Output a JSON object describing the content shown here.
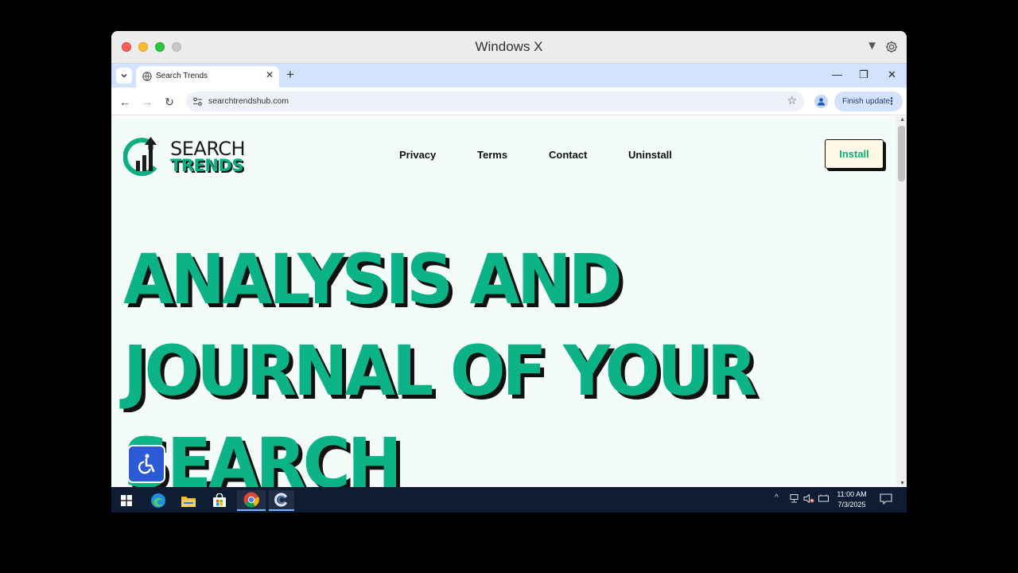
{
  "window": {
    "title": "Windows X",
    "title_arrow": "▼"
  },
  "tabstrip": {
    "tab_title": "Search Trends",
    "tab_close": "✕",
    "new_tab": "+",
    "minimize": "—",
    "restore": "❐",
    "close": "✕"
  },
  "toolbar": {
    "back": "←",
    "forward": "→",
    "reload": "↻",
    "url": "searchtrendshub.com",
    "bookmark_star": "☆",
    "finish_update": "Finish update",
    "menu_dots": "⋮"
  },
  "page": {
    "logo": {
      "line1": "SEARCH",
      "line2": "TRENDS"
    },
    "nav": [
      {
        "label": "Privacy"
      },
      {
        "label": "Terms"
      },
      {
        "label": "Contact"
      },
      {
        "label": "Uninstall"
      }
    ],
    "install_label": "Install",
    "hero": {
      "line1": "ANALYSIS AND",
      "line2": "JOURNAL OF YOUR",
      "line3": "SEARCH"
    }
  },
  "taskbar": {
    "time": "11:00 AM",
    "date": "7/3/2025",
    "tray_chevron": "^"
  },
  "colors": {
    "brand_green": "#0cb386",
    "page_bg": "#f4fcf9",
    "install_bg": "#fff8e5",
    "a11y_blue": "#2c5ad5",
    "taskbar_bg": "#0f1d34",
    "tabstrip_bg": "#d3e3fd"
  }
}
